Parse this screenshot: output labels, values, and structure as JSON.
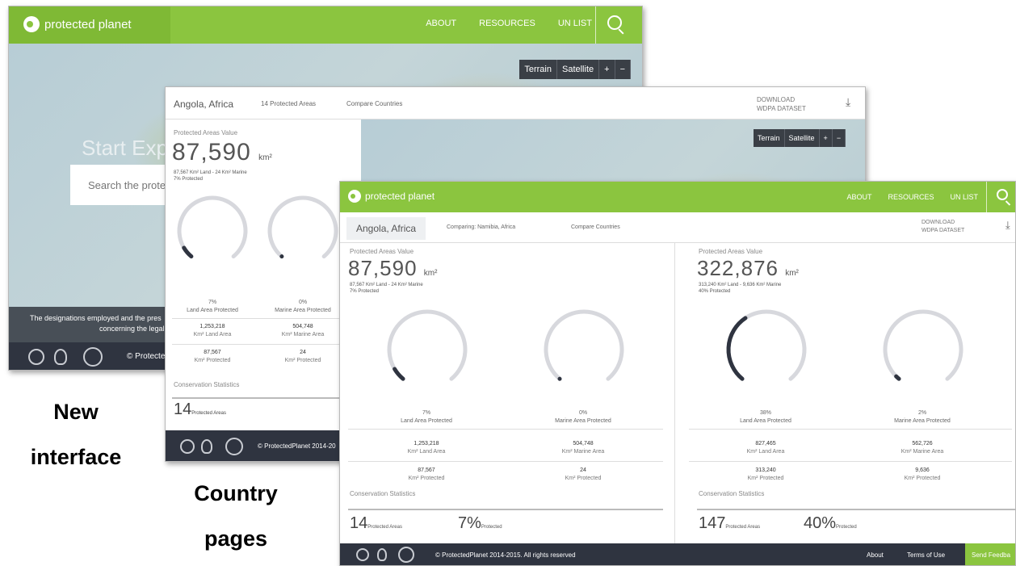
{
  "captions": {
    "new_line1": "New",
    "new_line2": "interface",
    "country_line1": "Country",
    "country_line2": "pages"
  },
  "brand": {
    "name": "protected planet",
    "color": "#8bc53f",
    "footer_color": "#2f3440"
  },
  "home": {
    "nav": [
      "ABOUT",
      "RESOURCES",
      "UN LIST"
    ],
    "map_controls": [
      "Terrain",
      "Satellite",
      "+",
      "−"
    ],
    "headline": "Start Explo",
    "search_placeholder": "Search the protec",
    "disclaimer_line1": "The designations employed and the pres",
    "disclaimer_line2": "concerning the legal st",
    "footer_text": "© Protecte"
  },
  "country_page": {
    "country": "Angola, Africa",
    "protected_areas_link": "14 Protected Areas",
    "compare_link": "Compare Countries",
    "download_line1": "DOWNLOAD",
    "download_line2": "WDPA DATASET",
    "map_controls": [
      "Terrain",
      "Satellite",
      "+",
      "−"
    ],
    "value_label": "Protected Areas Value",
    "value": "87,590",
    "unit": "km²",
    "land_marine": "87,567 Km² Land - 24 Km² Marine",
    "pct_protected": "7% Protected",
    "land_pct": "7%",
    "land_label": "Land Area Protected",
    "marine_pct": "0%",
    "marine_label": "Marine Area Protected",
    "land_area": "1,253,218",
    "land_area_label": "Km² Land Area",
    "marine_area": "504,748",
    "marine_area_label": "Km² Marine Area",
    "land_protected": "87,567",
    "land_protected_label": "Km² Protected",
    "marine_protected": "24",
    "marine_protected_label": "Km² Protected",
    "conservation_label": "Conservation Statistics",
    "pa_total": "14",
    "pa_total_label": "Protected Areas",
    "footer_text": "© ProtectedPlanet 2014-20"
  },
  "compare_page": {
    "nav": [
      "ABOUT",
      "RESOURCES",
      "UN LIST"
    ],
    "country": "Angola, Africa",
    "comparing": "Comparing: Namibia, Africa",
    "compare_link": "Compare Countries",
    "download_line1": "DOWNLOAD",
    "download_line2": "WDPA DATASET",
    "left": {
      "value_label": "Protected Areas Value",
      "value": "87,590",
      "unit": "km²",
      "land_marine": "87,567 Km² Land - 24 Km² Marine",
      "pct_protected": "7% Protected",
      "land_pct": "7%",
      "land_fill": 0.07,
      "land_label": "Land Area Protected",
      "marine_pct": "0%",
      "marine_fill": 0.0,
      "marine_label": "Marine Area Protected",
      "land_area": "1,253,218",
      "land_area_label": "Km² Land Area",
      "marine_area": "504,748",
      "marine_area_label": "Km² Marine Area",
      "land_protected": "87,567",
      "land_protected_label": "Km² Protected",
      "marine_protected": "24",
      "marine_protected_label": "Km² Protected",
      "conservation_label": "Conservation Statistics",
      "pa_total": "14",
      "pa_total_label": "Protected Areas",
      "pa_pct": "7%",
      "pa_pct_label": "Protected"
    },
    "right": {
      "value_label": "Protected Areas Value",
      "value": "322,876",
      "unit": "km²",
      "land_marine": "313,240 Km² Land - 9,636 Km² Marine",
      "pct_protected": "40% Protected",
      "land_pct": "38%",
      "land_fill": 0.38,
      "land_label": "Land Area Protected",
      "marine_pct": "2%",
      "marine_fill": 0.02,
      "marine_label": "Marine Area Protected",
      "land_area": "827,465",
      "land_area_label": "Km² Land Area",
      "marine_area": "562,726",
      "marine_area_label": "Km² Marine Area",
      "land_protected": "313,240",
      "land_protected_label": "Km² Protected",
      "marine_protected": "9,636",
      "marine_protected_label": "Km² Protected",
      "conservation_label": "Conservation Statistics",
      "pa_total": "147",
      "pa_total_label": "Protected Areas",
      "pa_pct": "40%",
      "pa_pct_label": "Protected"
    },
    "footer_text": "© ProtectedPlanet 2014-2015. All rights reserved",
    "footer_about": "About",
    "footer_terms": "Terms of Use",
    "footer_feedback": "Send Feedba"
  }
}
